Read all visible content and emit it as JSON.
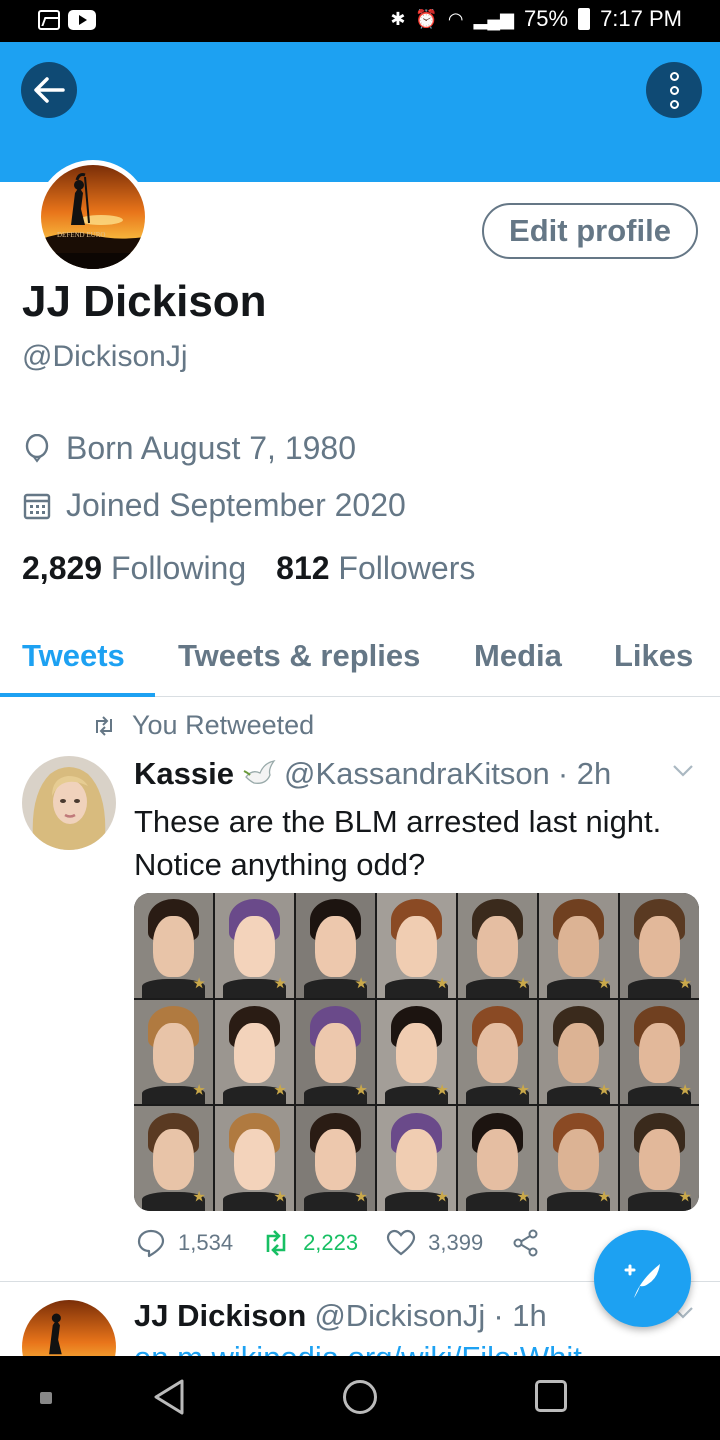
{
  "status": {
    "battery": "75%",
    "time": "7:17 PM"
  },
  "profile": {
    "name": "JJ Dickison",
    "handle": "@DickisonJj",
    "edit_label": "Edit profile",
    "avatar_text": "DEFEND EURO",
    "born": "Born August 7, 1980",
    "joined": "Joined September 2020",
    "following_count": "2,829",
    "following_label": "Following",
    "followers_count": "812",
    "followers_label": "Followers"
  },
  "tabs": [
    "Tweets",
    "Tweets & replies",
    "Media",
    "Likes"
  ],
  "active_tab": "Tweets",
  "tweet1": {
    "retweet_label": "You Retweeted",
    "author": "Kassie",
    "handle": "@KassandraKitson",
    "time": "· 2h",
    "text": "These are the BLM arrested last night. Notice anything odd?",
    "replies": "1,534",
    "retweets": "2,223",
    "likes": "3,399"
  },
  "tweet2": {
    "author": "JJ Dickison",
    "handle": "@DickisonJj",
    "time": "· 1h",
    "text": "en.m.wikipedia.org/wiki/File:Whit"
  },
  "colors": {
    "accent": "#1da1f2",
    "header_button": "#0f4a74",
    "muted": "#657786",
    "retweet": "#17bf63"
  }
}
